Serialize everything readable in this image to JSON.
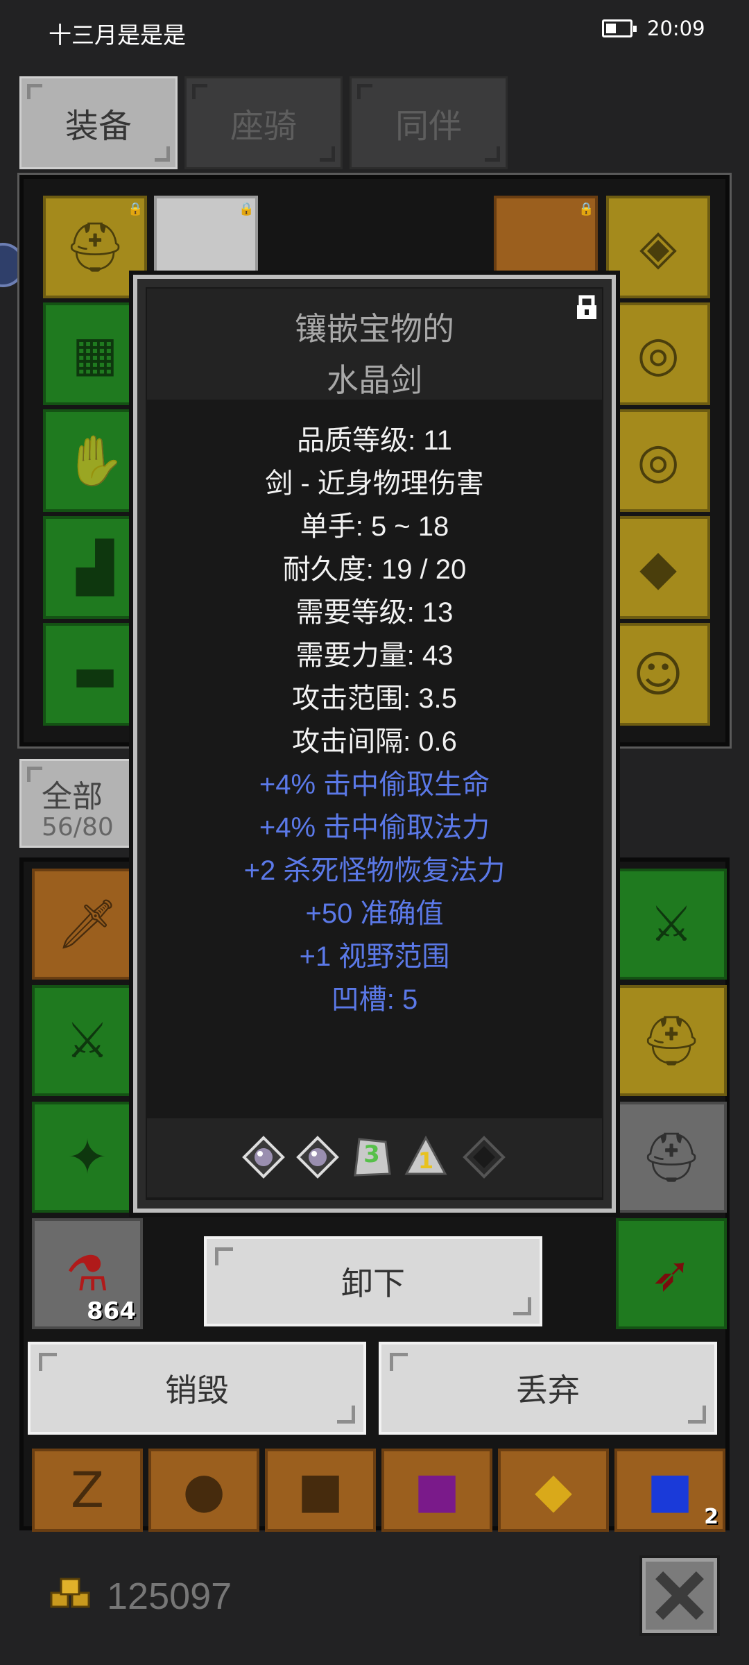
{
  "status": {
    "left_text": "十三月是是是",
    "time": "20:09"
  },
  "tabs": [
    {
      "label": "装备",
      "active": true
    },
    {
      "label": "座骑",
      "active": false
    },
    {
      "label": "同伴",
      "active": false
    }
  ],
  "bag": {
    "tab_label": "全部",
    "count": "56/80",
    "potion_count": "864",
    "stack_count": "2"
  },
  "tooltip": {
    "title_line1": "镶嵌宝物的",
    "title_line2": "水晶剑",
    "stats": [
      "品质等级: 11",
      "剑 - 近身物理伤害",
      "单手: 5 ~ 18",
      "耐久度: 19 / 20",
      "需要等级: 13",
      "需要力量: 43",
      "攻击范围: 3.5",
      "攻击间隔: 0.6"
    ],
    "affixes": [
      "+4% 击中偷取生命",
      "+4% 击中偷取法力",
      "+2 杀死怪物恢复法力",
      "+50 准确值",
      "+1 视野范围",
      "凹槽: 5"
    ],
    "gems": [
      {
        "icon": "white-diamond-gem-icon"
      },
      {
        "icon": "white-diamond-gem-icon"
      },
      {
        "icon": "green-rune-3-icon",
        "label": "3"
      },
      {
        "icon": "yellow-rune-1-icon",
        "label": "1"
      },
      {
        "icon": "empty-socket-icon"
      }
    ]
  },
  "buttons": {
    "unequip": "卸下",
    "destroy": "销毁",
    "drop": "丢弃"
  },
  "gold": {
    "value": "125097"
  },
  "colors": {
    "affix_blue": "#5b79e8",
    "stat_white": "#f2f2f2",
    "slot_gold": "#a48a1c",
    "slot_green": "#1f7a1f",
    "slot_orange": "#9b5f1e"
  }
}
